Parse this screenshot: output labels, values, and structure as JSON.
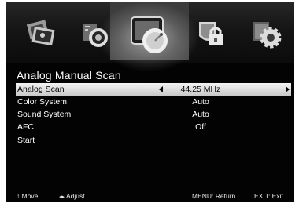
{
  "menu": {
    "tabs": [
      {
        "name": "picture",
        "icon": "photo-icon",
        "selected": false
      },
      {
        "name": "sound",
        "icon": "speaker-icon",
        "selected": false
      },
      {
        "name": "channel",
        "icon": "satellite-dish-icon",
        "selected": true
      },
      {
        "name": "lock",
        "icon": "lock-shield-icon",
        "selected": false
      },
      {
        "name": "setup",
        "icon": "gear-icon",
        "selected": false
      }
    ]
  },
  "page": {
    "title": "Analog Manual Scan"
  },
  "rows": [
    {
      "label": "Analog Scan",
      "value": "44.25 MHz",
      "highlighted": true
    },
    {
      "label": "Color System",
      "value": "Auto"
    },
    {
      "label": "Sound System",
      "value": "Auto"
    },
    {
      "label": "AFC",
      "value": "Off"
    },
    {
      "label": "Start",
      "value": ""
    }
  ],
  "footer": {
    "move_icon": "up-down-arrows-icon",
    "move": "Move",
    "adjust_icon": "left-right-arrows-icon",
    "adjust": "Adjust",
    "return": "MENU: Return",
    "exit": "EXIT: Exit"
  },
  "colors": {
    "background": "#030303",
    "highlight": "#e6e6e6",
    "text": "#ffffff"
  }
}
